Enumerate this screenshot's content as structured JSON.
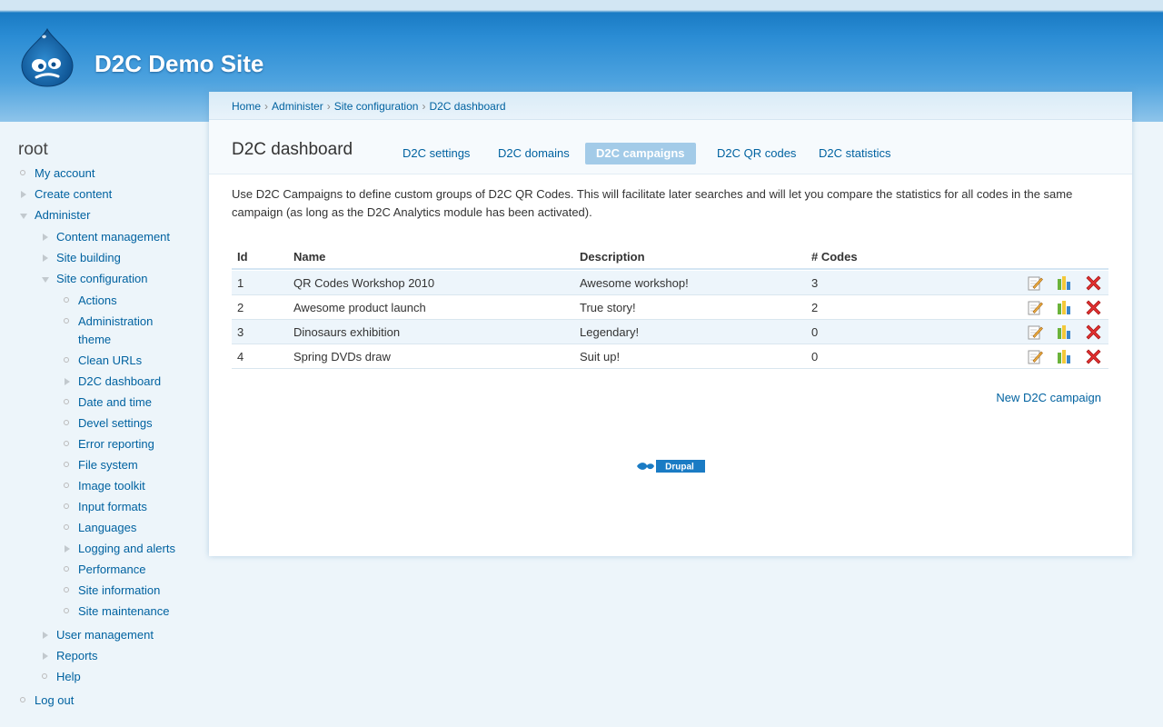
{
  "site": {
    "name": "D2C Demo Site"
  },
  "sidebar": {
    "user": "root",
    "items": [
      {
        "label": "My account",
        "level": 0,
        "bullet": "circle"
      },
      {
        "label": "Create content",
        "level": 0,
        "bullet": "tri-right"
      },
      {
        "label": "Administer",
        "level": 0,
        "bullet": "tri-down"
      },
      {
        "label": "Content management",
        "level": 1,
        "bullet": "tri-right"
      },
      {
        "label": "Site building",
        "level": 1,
        "bullet": "tri-right"
      },
      {
        "label": "Site configuration",
        "level": 1,
        "bullet": "tri-down"
      },
      {
        "label": "Actions",
        "level": 2,
        "bullet": "circle"
      },
      {
        "label": "Administration theme",
        "level": 2,
        "bullet": "circle"
      },
      {
        "label": "Clean URLs",
        "level": 2,
        "bullet": "circle"
      },
      {
        "label": "D2C dashboard",
        "level": 2,
        "bullet": "tri-right"
      },
      {
        "label": "Date and time",
        "level": 2,
        "bullet": "circle"
      },
      {
        "label": "Devel settings",
        "level": 2,
        "bullet": "circle"
      },
      {
        "label": "Error reporting",
        "level": 2,
        "bullet": "circle"
      },
      {
        "label": "File system",
        "level": 2,
        "bullet": "circle"
      },
      {
        "label": "Image toolkit",
        "level": 2,
        "bullet": "circle"
      },
      {
        "label": "Input formats",
        "level": 2,
        "bullet": "circle"
      },
      {
        "label": "Languages",
        "level": 2,
        "bullet": "circle"
      },
      {
        "label": "Logging and alerts",
        "level": 2,
        "bullet": "tri-right"
      },
      {
        "label": "Performance",
        "level": 2,
        "bullet": "circle"
      },
      {
        "label": "Site information",
        "level": 2,
        "bullet": "circle"
      },
      {
        "label": "Site maintenance",
        "level": 2,
        "bullet": "circle"
      },
      {
        "label": "User management",
        "level": 1,
        "bullet": "tri-right"
      },
      {
        "label": "Reports",
        "level": 1,
        "bullet": "tri-right"
      },
      {
        "label": "Help",
        "level": 1,
        "bullet": "circle"
      },
      {
        "label": "Log out",
        "level": 0,
        "bullet": "circle"
      }
    ]
  },
  "breadcrumb": [
    "Home",
    "Administer",
    "Site configuration",
    "D2C dashboard"
  ],
  "page": {
    "title": "D2C dashboard",
    "description": "Use D2C Campaigns to define custom groups of D2C QR Codes. This will facilitate later searches and will let you compare the statistics for all codes in the same campaign (as long as the D2C Analytics module has been activated)."
  },
  "tabs": [
    {
      "label": "D2C settings",
      "active": false
    },
    {
      "label": "D2C domains",
      "active": false
    },
    {
      "label": "D2C campaigns",
      "active": true
    },
    {
      "label": "D2C QR codes",
      "active": false
    },
    {
      "label": "D2C statistics",
      "active": false
    }
  ],
  "table": {
    "headers": {
      "id": "Id",
      "name": "Name",
      "description": "Description",
      "codes": "# Codes"
    },
    "rows": [
      {
        "id": "1",
        "name": "QR Codes Workshop 2010",
        "description": "Awesome workshop!",
        "codes": "3"
      },
      {
        "id": "2",
        "name": "Awesome product launch",
        "description": "True story!",
        "codes": "2"
      },
      {
        "id": "3",
        "name": "Dinosaurs exhibition",
        "description": "Legendary!",
        "codes": "0"
      },
      {
        "id": "4",
        "name": "Spring DVDs draw",
        "description": "Suit up!",
        "codes": "0"
      }
    ],
    "row_icons": [
      "edit-icon",
      "stats-icon",
      "delete-icon"
    ]
  },
  "actions": {
    "new_campaign": "New D2C campaign"
  },
  "footer": {
    "badge_label": "Drupal"
  },
  "colors": {
    "link": "#0062a0",
    "active_tab": "#a3cbe8",
    "header_blue": "#2a8cd4",
    "row_alt": "#edf5fb"
  }
}
